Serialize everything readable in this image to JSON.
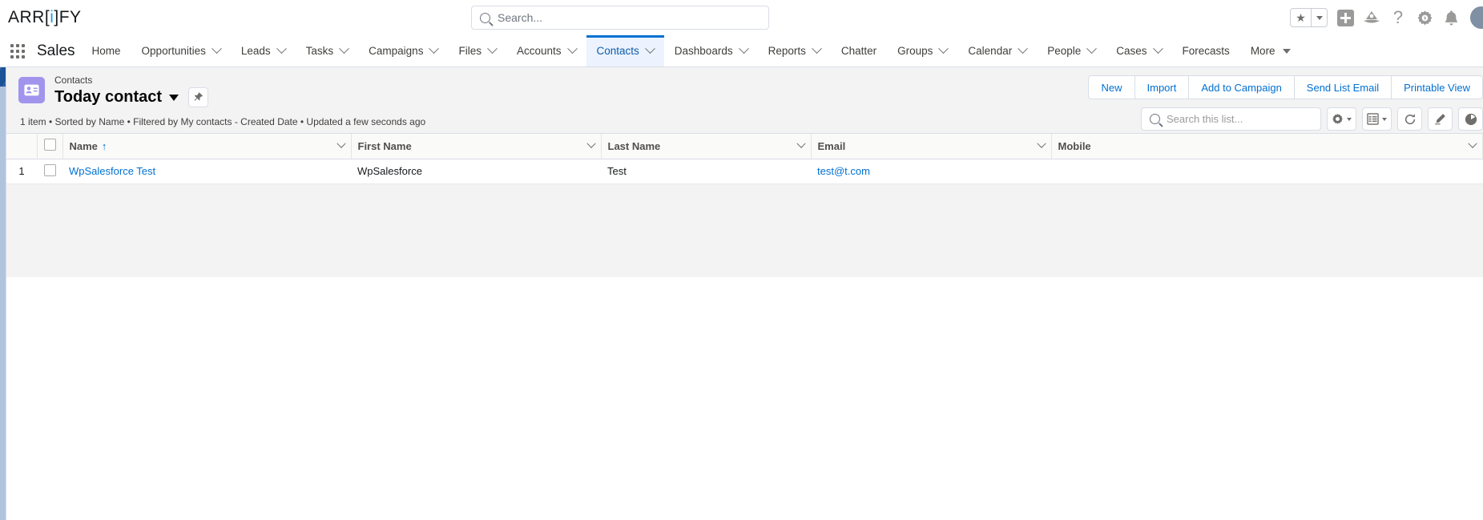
{
  "header": {
    "logo_text_1": "ARR",
    "logo_bracket_open": "[",
    "logo_highlight": "i",
    "logo_bracket_close": "]",
    "logo_text_2": "FY",
    "search_placeholder": "Search...",
    "icons": {
      "favorites": "★",
      "help": "?"
    }
  },
  "nav": {
    "app_name": "Sales",
    "items": [
      {
        "label": "Home",
        "has_menu": false
      },
      {
        "label": "Opportunities",
        "has_menu": true
      },
      {
        "label": "Leads",
        "has_menu": true
      },
      {
        "label": "Tasks",
        "has_menu": true
      },
      {
        "label": "Campaigns",
        "has_menu": true
      },
      {
        "label": "Files",
        "has_menu": true
      },
      {
        "label": "Accounts",
        "has_menu": true
      },
      {
        "label": "Contacts",
        "has_menu": true,
        "active": true
      },
      {
        "label": "Dashboards",
        "has_menu": true
      },
      {
        "label": "Reports",
        "has_menu": true
      },
      {
        "label": "Chatter",
        "has_menu": false
      },
      {
        "label": "Groups",
        "has_menu": true
      },
      {
        "label": "Calendar",
        "has_menu": true
      },
      {
        "label": "People",
        "has_menu": true
      },
      {
        "label": "Cases",
        "has_menu": true
      },
      {
        "label": "Forecasts",
        "has_menu": false
      },
      {
        "label": "More",
        "has_menu": false,
        "triangle": true
      }
    ]
  },
  "list_view": {
    "breadcrumb": "Contacts",
    "title": "Today contact",
    "meta": "1 item • Sorted by Name • Filtered by My contacts - Created Date • Updated a few seconds ago",
    "actions": [
      "New",
      "Import",
      "Add to Campaign",
      "Send List Email",
      "Printable View"
    ],
    "search_placeholder": "Search this list...",
    "toolbar_icons": [
      "gear-icon",
      "list-view-controls-icon",
      "refresh-icon",
      "edit-pencil-icon",
      "chart-icon"
    ]
  },
  "table": {
    "columns": [
      {
        "label": "Name",
        "sorted": "asc",
        "sort_glyph": "↑"
      },
      {
        "label": "First Name"
      },
      {
        "label": "Last Name"
      },
      {
        "label": "Email"
      },
      {
        "label": "Mobile"
      }
    ],
    "rows": [
      {
        "index": "1",
        "name": "WpSalesforce Test",
        "first_name": "WpSalesforce",
        "last_name": "Test",
        "email": "test@t.com",
        "mobile": ""
      }
    ]
  },
  "colors": {
    "link": "#0070d2",
    "active_tab_bg": "#ecf3fe",
    "active_tab_border": "#0070d2",
    "object_icon": "#a094ed",
    "band": "#1b5297"
  }
}
